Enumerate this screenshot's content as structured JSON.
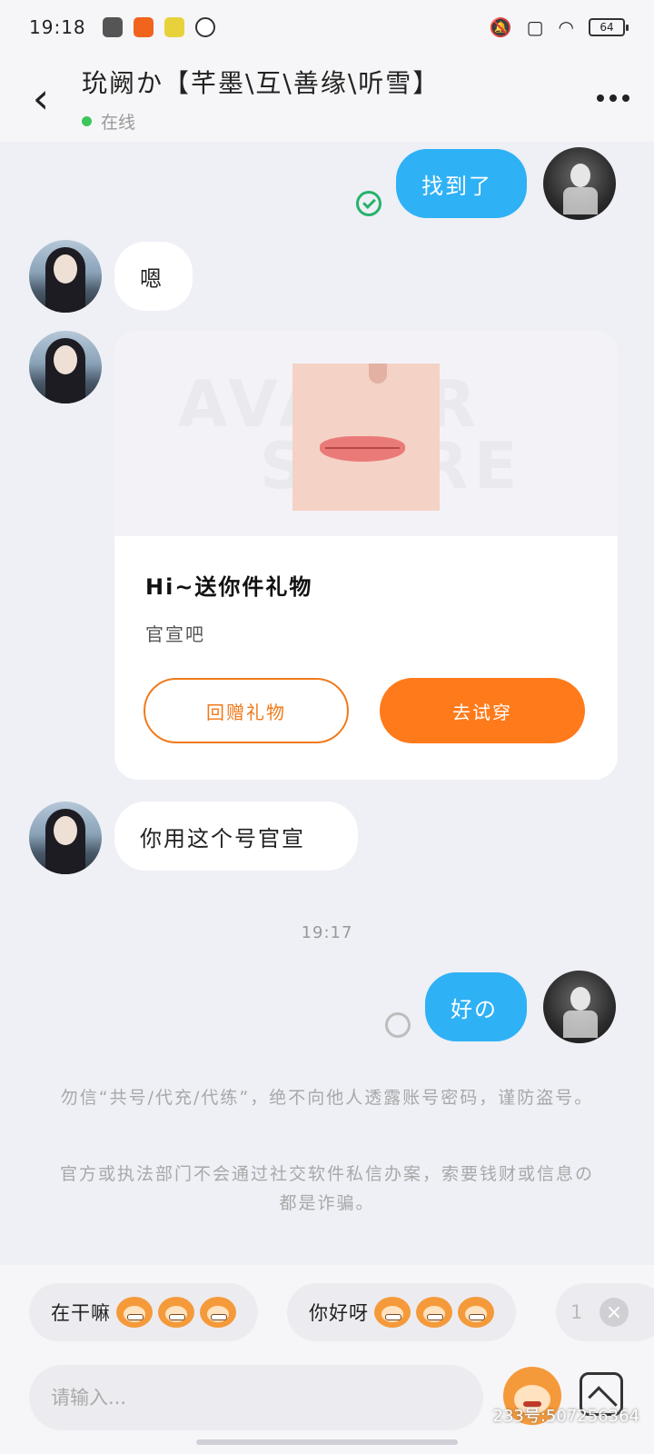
{
  "status_bar": {
    "time": "19:18",
    "battery": "64",
    "app_icon_colors": [
      "#555555",
      "#f0641e",
      "#e8d23c",
      "#333333"
    ]
  },
  "header": {
    "back_icon": "chevron-left-icon",
    "title": "玧阙か【芊墨\\互\\善缘\\听雪】",
    "status_text": "在线",
    "status_color": "#3cc65a",
    "more_icon": "more-dots-icon"
  },
  "messages": [
    {
      "side": "out",
      "text": "找到了",
      "state": "read"
    },
    {
      "side": "in",
      "text": "嗯"
    },
    {
      "side": "in",
      "type": "gift",
      "title": "Hi~送你件礼物",
      "subtitle": "官宣吧",
      "watermark_line1": "AVATAR",
      "watermark_line2": "STORE",
      "button_return": "回赠礼物",
      "button_try": "去试穿"
    },
    {
      "side": "in",
      "text": "你用这个号官宣"
    },
    {
      "type": "time",
      "text": "19:17"
    },
    {
      "side": "out",
      "text": "好の",
      "state": "sending"
    }
  ],
  "notices": [
    "勿信“共号/代充/代练”，绝不向他人透露账号密码，谨防盗号。",
    "官方或执法部门不会通过社交软件私信办案，索要钱财或信息の都是诈骗。"
  ],
  "quick_replies": [
    {
      "text": "在干嘛",
      "emoji": "monkey-grin-icon",
      "count": 3
    },
    {
      "text": "你好呀",
      "emoji": "monkey-smile-icon",
      "count": 3
    },
    {
      "text": "1",
      "emoji": "",
      "count": 0
    }
  ],
  "input": {
    "placeholder": "请输入...",
    "value": ""
  },
  "watermark": "233号:507256364",
  "colors": {
    "outgoing_bubble": "#2fb1f5",
    "accent_orange": "#ff7a1a",
    "background": "#eef0f6"
  }
}
